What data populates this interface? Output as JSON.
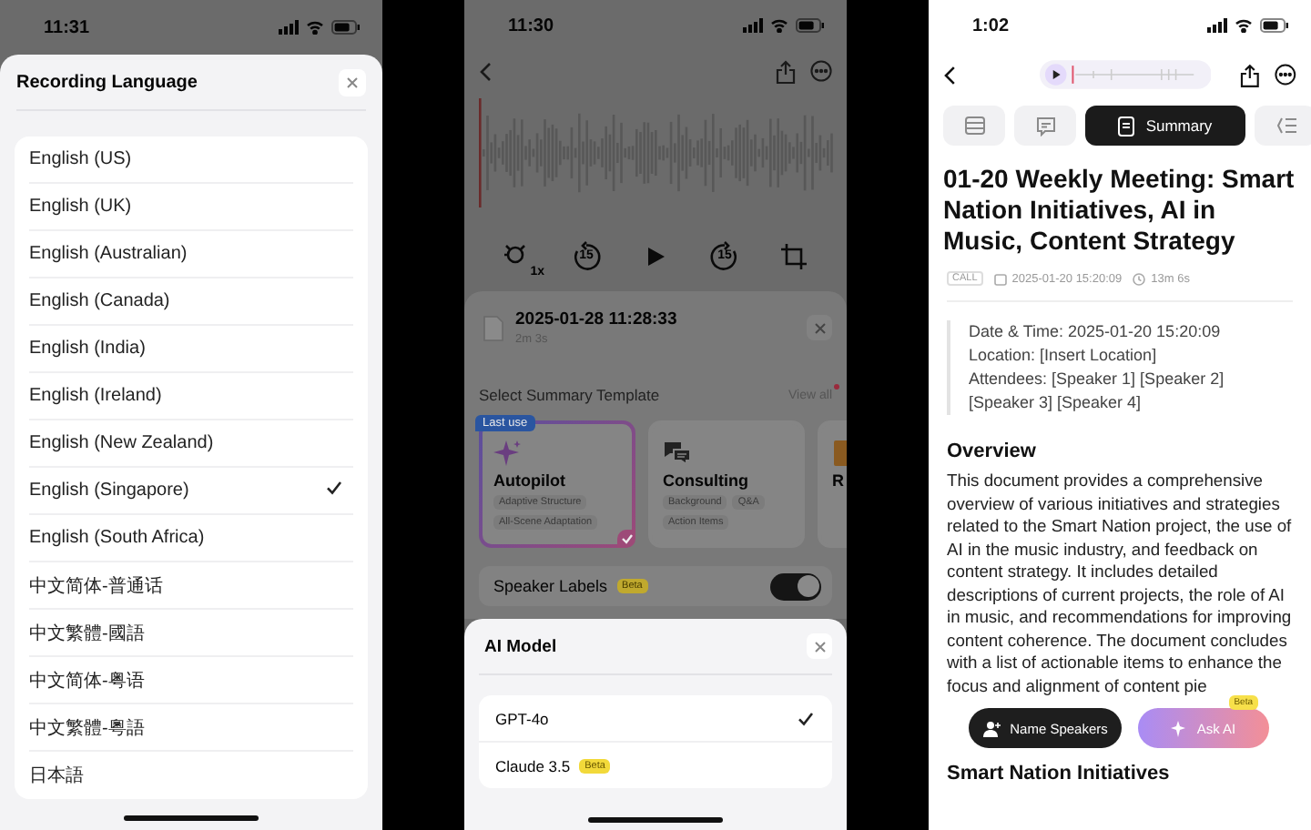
{
  "language_screen": {
    "status_bar": {
      "time": "11:31"
    },
    "title": "Recording Language",
    "languages": [
      {
        "name": "English (US)",
        "selected": false
      },
      {
        "name": "English (UK)",
        "selected": false
      },
      {
        "name": "English (Australian)",
        "selected": false
      },
      {
        "name": "English (Canada)",
        "selected": false
      },
      {
        "name": "English (India)",
        "selected": false
      },
      {
        "name": "English (Ireland)",
        "selected": false
      },
      {
        "name": "English (New Zealand)",
        "selected": false
      },
      {
        "name": "English (Singapore)",
        "selected": true
      },
      {
        "name": "English (South Africa)",
        "selected": false
      },
      {
        "name": "中文简体-普通话",
        "selected": false
      },
      {
        "name": "中文繁體-國語",
        "selected": false
      },
      {
        "name": "中文简体-粤语",
        "selected": false
      },
      {
        "name": "中文繁體-粵語",
        "selected": false
      },
      {
        "name": "日本語",
        "selected": false
      }
    ]
  },
  "template_screen": {
    "status_bar": {
      "time": "11:30"
    },
    "controls": [
      {
        "kind": "speed",
        "label": "1x"
      },
      {
        "kind": "rewind",
        "label": "15"
      },
      {
        "kind": "play"
      },
      {
        "kind": "forward",
        "label": "15"
      },
      {
        "kind": "trim"
      }
    ],
    "recording": {
      "title": "2025-01-28 11:28:33",
      "duration": "2m 3s"
    },
    "section_title": "Select Summary Template",
    "view_all": "View all",
    "templates": [
      {
        "name": "Autopilot",
        "badge": "Last use",
        "selected": true,
        "tags": [
          "Adaptive Structure",
          "All-Scene Adaptation"
        ]
      },
      {
        "name": "Consulting",
        "selected": false,
        "tags": [
          "Background",
          "Q&A",
          "Action Items"
        ]
      },
      {
        "name": "R",
        "selected": false
      }
    ],
    "speaker_labels": {
      "label": "Speaker Labels",
      "badge": "Beta",
      "on": true
    },
    "ai_model_sheet": {
      "title": "AI Model",
      "models": [
        {
          "name": "GPT-4o",
          "selected": true
        },
        {
          "name": "Claude 3.5",
          "badge": "Beta",
          "selected": false
        }
      ]
    }
  },
  "summary_screen": {
    "status_bar": {
      "time": "1:02"
    },
    "tabs": [
      {
        "kind": "list",
        "selected": false
      },
      {
        "kind": "chat",
        "selected": false
      },
      {
        "kind": "summary",
        "label": "Summary",
        "selected": true
      },
      {
        "kind": "outline",
        "selected": false
      }
    ],
    "title": "01-20 Weekly Meeting: Smart Nation Initiatives, AI in Music, Content Strategy",
    "meta": {
      "type": "CALL",
      "date": "2025-01-20 15:20:09",
      "duration": "13m 6s"
    },
    "details": [
      "Date & Time: 2025-01-20 15:20:09",
      "Location: [Insert Location]",
      "Attendees: [Speaker 1] [Speaker 2] [Speaker 3] [Speaker 4]"
    ],
    "overview_heading": "Overview",
    "overview_text": "This document provides a comprehensive overview of various initiatives and strategies related to the Smart Nation project, the use of AI in the music industry, and feedback on content strategy. It includes detailed descriptions of current projects, the role of AI in music, and recommendations for improving content coherence. The document concludes with a list of actionable items to enhance the focus and alignment of content pie",
    "actions": [
      {
        "kind": "dark",
        "label": "Name Speakers"
      },
      {
        "kind": "gradient",
        "label": "Ask AI",
        "badge": "Beta"
      }
    ],
    "next_heading": "Smart Nation Initiatives"
  }
}
